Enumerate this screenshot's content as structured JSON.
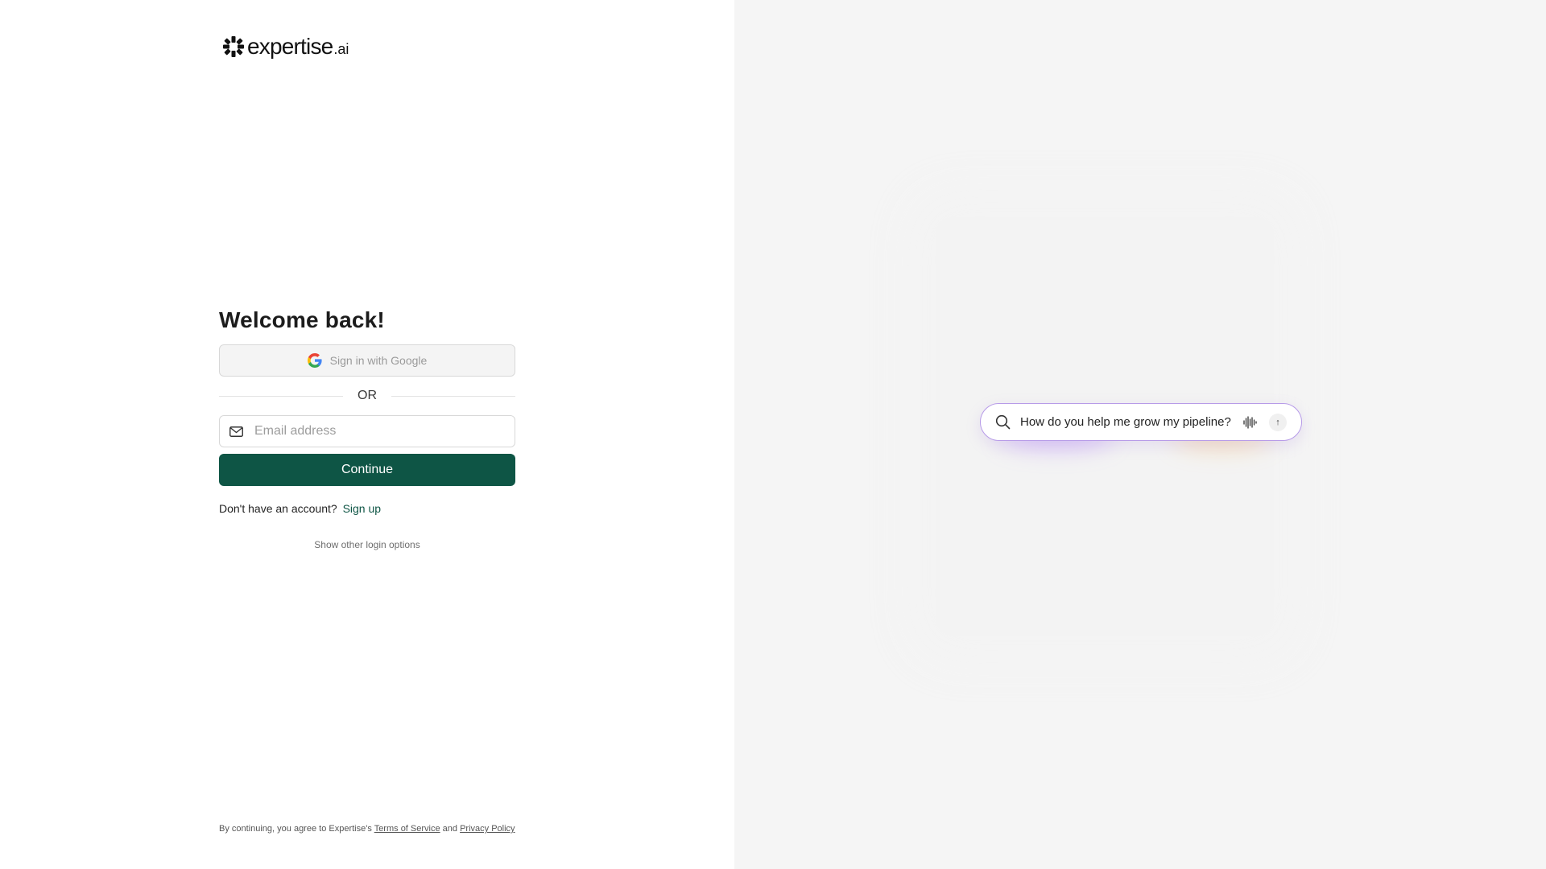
{
  "brand": {
    "name": "expertise",
    "suffix": ".ai"
  },
  "login": {
    "heading": "Welcome back!",
    "google_label": "Sign in with Google",
    "divider_text": "OR",
    "email_placeholder": "Email address",
    "email_value": "",
    "continue_label": "Continue",
    "signup_prompt": "Don't have an account?",
    "signup_link": "Sign up",
    "other_options": "Show other login options"
  },
  "footer": {
    "prefix": "By continuing, you agree to Expertise's",
    "terms": "Terms of Service",
    "and": "and",
    "privacy": "Privacy Policy"
  },
  "showcase": {
    "search_text": "How do you help me grow my pipeline?",
    "icons": [
      "search-icon",
      "voice-wave-icon",
      "arrow-up-icon"
    ]
  },
  "colors": {
    "primary": "#0e5545",
    "right_panel_bg": "#f5f5f5",
    "search_border": "#b79be8"
  }
}
